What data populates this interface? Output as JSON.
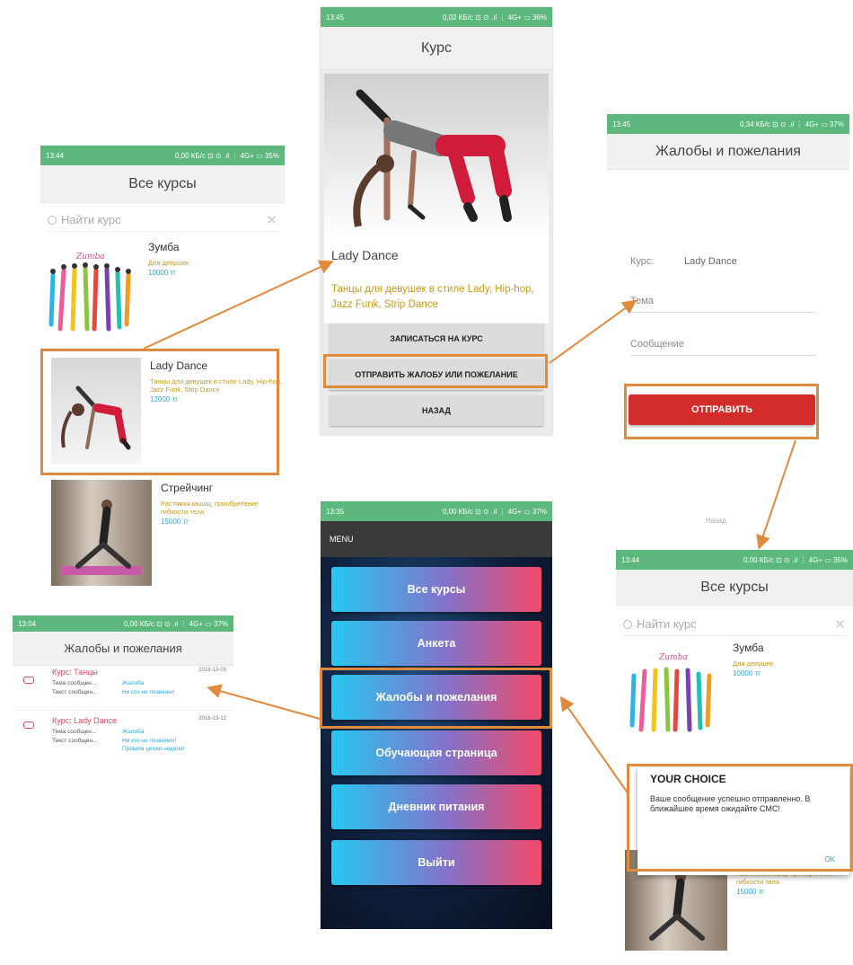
{
  "status": {
    "left_time": "13:44",
    "left_icons": "0,00 КБ/с ⊡ ⊙ .ıl ⋮ 4G+ ▭ 35%",
    "center_time": "13:45",
    "center_icons": "0,02 КБ/с ⊡ ⊙ .ıl ⋮ 4G+ ▭ 36%",
    "right_time": "13:45",
    "right_icons": "0,34 КБ/с ⊡ ⊙ .ıl ⋮ 4G+ ▭ 37%",
    "menu_time": "13:35",
    "menu_icons": "0,00 КБ/с ⊡ ⊙ .ıl ⋮ 4G+ ▭ 37%",
    "complaints_time": "13:04",
    "complaints_icons": "0,00 КБ/с ⊡ ⊙ .ıl ⋮ 4G+ ▭ 37%",
    "choice_time": "13:44",
    "choice_icons": "0,00 КБ/с ⊡ ⊙ .ıl ⋮ 4G+ ▭ 35%"
  },
  "all_courses": {
    "title": "Все курсы",
    "search_placeholder": "Найти курс",
    "zumba_logo": "Zumba",
    "courses": [
      {
        "name": "Зумба",
        "desc": "Для девушек",
        "price": "10000 тг"
      },
      {
        "name": "Lady Dance",
        "desc": "Танцы для девушек в стиле Lady, Hip-hop, Jazz Funk, Strip Dance",
        "price": "12000 тг"
      },
      {
        "name": "Стрейчинг",
        "desc": "Растяжка мышц, приобретение гибкости тела",
        "price": "15000 тг"
      }
    ]
  },
  "course_detail": {
    "title": "Курс",
    "name": "Lady Dance",
    "desc": "Танцы для девушек в стиле Lady, Hip-hop, Jazz Funk, Strip Dance",
    "btn_enroll": "ЗАПИСАТЬСЯ НА КУРС",
    "btn_complaint": "ОТПРАВИТЬ ЖАЛОБУ ИЛИ ПОЖЕЛАНИЕ",
    "btn_back": "НАЗАД"
  },
  "complaint_form": {
    "title": "Жалобы и пожелания",
    "course_label": "Курс:",
    "course_value": "Lady Dance",
    "topic_placeholder": "Тема",
    "message_placeholder": "Сообщение",
    "send_label": "ОТПРАВИТЬ",
    "back_label": "Назад"
  },
  "menu": {
    "header": "MENU",
    "items": [
      "Все курсы",
      "Анкета",
      "Жалобы и пожелания",
      "Обучающая страница",
      "Дневник питания",
      "Выйти"
    ]
  },
  "complaints_list": {
    "title": "Жалобы и пожелания",
    "items": [
      {
        "course": "Курс: Танцы",
        "date": "2018-13-03",
        "topic_label": "Тема сообщен...",
        "topic_value": "Жалоба",
        "text_label": "Текст сообщен...",
        "text_value": "Ни кто не позвонил",
        "text_extra": ""
      },
      {
        "course": "Курс: Lady Dance",
        "date": "2018-13-12",
        "topic_label": "Тема сообщен...",
        "topic_value": "Жалоба",
        "text_label": "Текст сообщен...",
        "text_value": "Ни кто не позвонил!",
        "text_extra": "Прошла целая неделя!"
      }
    ]
  },
  "choice_dialog": {
    "title": "YOUR CHOICE",
    "message": "Ваше сообщение успешно отправленно. В ближайшее время ожидайте СМС!",
    "ok": "OK"
  },
  "colors": {
    "accent": "#e08a3c",
    "status_green": "#5cb87d",
    "send_red": "#d42b2b",
    "price_blue": "#27a9e1",
    "desc_gold": "#c79a1b"
  }
}
